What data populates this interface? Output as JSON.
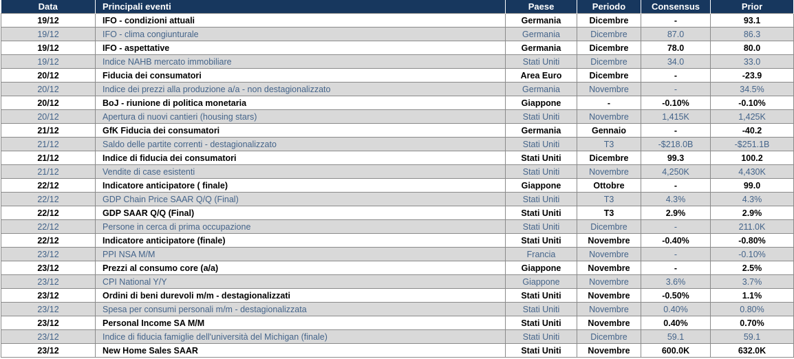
{
  "headers": {
    "date": "Data",
    "event": "Principali eventi",
    "country": "Paese",
    "period": "Periodo",
    "consensus": "Consensus",
    "prior": "Prior"
  },
  "rows": [
    {
      "date": "19/12",
      "event": "IFO - condizioni attuali",
      "country": "Germania",
      "period": "Dicembre",
      "consensus": "-",
      "prior": "93.1",
      "style": "bold"
    },
    {
      "date": "19/12",
      "event": "IFO - clima congiunturale",
      "country": "Germania",
      "period": "Dicembre",
      "consensus": "87.0",
      "prior": "86.3",
      "style": "light"
    },
    {
      "date": "19/12",
      "event": "IFO - aspettative",
      "country": "Germania",
      "period": "Dicembre",
      "consensus": "78.0",
      "prior": "80.0",
      "style": "bold"
    },
    {
      "date": "19/12",
      "event": "Indice NAHB mercato immobiliare",
      "country": "Stati Uniti",
      "period": "Dicembre",
      "consensus": "34.0",
      "prior": "33.0",
      "style": "light"
    },
    {
      "date": "20/12",
      "event": "Fiducia dei consumatori",
      "country": "Area Euro",
      "period": "Dicembre",
      "consensus": "-",
      "prior": "-23.9",
      "style": "bold"
    },
    {
      "date": "20/12",
      "event": "Indice dei prezzi alla produzione a/a -  non destagionalizzato",
      "country": "Germania",
      "period": "Novembre",
      "consensus": "-",
      "prior": "34.5%",
      "style": "light"
    },
    {
      "date": "20/12",
      "event": "BoJ - riunione di politica monetaria",
      "country": "Giappone",
      "period": "-",
      "consensus": "-0.10%",
      "prior": "-0.10%",
      "style": "bold"
    },
    {
      "date": "20/12",
      "event": "Apertura di nuovi cantieri (housing stars)",
      "country": "Stati Uniti",
      "period": "Novembre",
      "consensus": "1,415K",
      "prior": "1,425K",
      "style": "light"
    },
    {
      "date": "21/12",
      "event": "GfK Fiducia dei consumatori",
      "country": "Germania",
      "period": "Gennaio",
      "consensus": "-",
      "prior": "-40.2",
      "style": "bold"
    },
    {
      "date": "21/12",
      "event": "Saldo delle partite correnti - destagionalizzato",
      "country": "Stati Uniti",
      "period": "T3",
      "consensus": "-$218.0B",
      "prior": "-$251.1B",
      "style": "light"
    },
    {
      "date": "21/12",
      "event": "Indice di fiducia dei consumatori",
      "country": "Stati Uniti",
      "period": "Dicembre",
      "consensus": "99.3",
      "prior": "100.2",
      "style": "bold"
    },
    {
      "date": "21/12",
      "event": "Vendite di case esistenti",
      "country": "Stati Uniti",
      "period": "Novembre",
      "consensus": "4,250K",
      "prior": "4,430K",
      "style": "light"
    },
    {
      "date": "22/12",
      "event": "Indicatore anticipatore ( finale)",
      "country": "Giappone",
      "period": "Ottobre",
      "consensus": "-",
      "prior": "99.0",
      "style": "bold"
    },
    {
      "date": "22/12",
      "event": "GDP Chain Price SAAR Q/Q (Final)",
      "country": "Stati Uniti",
      "period": "T3",
      "consensus": "4.3%",
      "prior": "4.3%",
      "style": "light"
    },
    {
      "date": "22/12",
      "event": "GDP SAAR Q/Q (Final)",
      "country": "Stati Uniti",
      "period": "T3",
      "consensus": "2.9%",
      "prior": "2.9%",
      "style": "bold"
    },
    {
      "date": "22/12",
      "event": "Persone in cerca di prima occupazione",
      "country": "Stati Uniti",
      "period": "Dicembre",
      "consensus": "-",
      "prior": "211.0K",
      "style": "light"
    },
    {
      "date": "22/12",
      "event": "Indicatore anticipatore (finale)",
      "country": "Stati Uniti",
      "period": "Novembre",
      "consensus": "-0.40%",
      "prior": "-0.80%",
      "style": "bold"
    },
    {
      "date": "23/12",
      "event": "PPI NSA M/M",
      "country": "Francia",
      "period": "Novembre",
      "consensus": "-",
      "prior": "-0.10%",
      "style": "light"
    },
    {
      "date": "23/12",
      "event": "Prezzi al consumo core (a/a)",
      "country": "Giappone",
      "period": "Novembre",
      "consensus": "-",
      "prior": "2.5%",
      "style": "bold"
    },
    {
      "date": "23/12",
      "event": "CPI National Y/Y",
      "country": "Giappone",
      "period": "Novembre",
      "consensus": "3.6%",
      "prior": "3.7%",
      "style": "light"
    },
    {
      "date": "23/12",
      "event": "Ordini di beni durevoli m/m - destagionalizzati",
      "country": "Stati Uniti",
      "period": "Novembre",
      "consensus": "-0.50%",
      "prior": "1.1%",
      "style": "bold"
    },
    {
      "date": "23/12",
      "event": "Spesa per consumi personali m/m - destagionalizzata",
      "country": "Stati Uniti",
      "period": "Novembre",
      "consensus": "0.40%",
      "prior": "0.80%",
      "style": "light"
    },
    {
      "date": "23/12",
      "event": "Personal Income SA M/M",
      "country": "Stati Uniti",
      "period": "Novembre",
      "consensus": "0.40%",
      "prior": "0.70%",
      "style": "bold"
    },
    {
      "date": "23/12",
      "event": "Indice di fiducia famiglie dell'università del Michigan (finale)",
      "country": "Stati Uniti",
      "period": "Dicembre",
      "consensus": "59.1",
      "prior": "59.1",
      "style": "light"
    },
    {
      "date": "23/12",
      "event": "New Home Sales SAAR",
      "country": "Stati Uniti",
      "period": "Novembre",
      "consensus": "600.0K",
      "prior": "632.0K",
      "style": "bold"
    }
  ],
  "colors": {
    "header_bg": "#17375e",
    "header_text": "#ffffff",
    "light_row_bg": "#d9d9d9",
    "light_row_text": "#44648a",
    "bold_row_text": "#000000"
  }
}
